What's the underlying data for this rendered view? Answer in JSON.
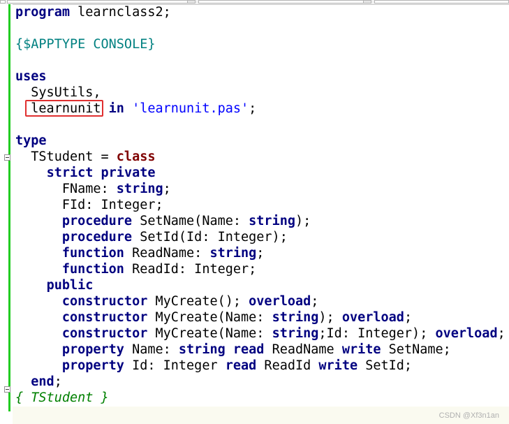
{
  "editor": {
    "lines": [
      [
        {
          "t": "program",
          "c": "kw"
        },
        {
          "t": " learnclass2;",
          "c": ""
        }
      ],
      [],
      [
        {
          "t": "{$APPTYPE CONSOLE}",
          "c": "dir"
        }
      ],
      [],
      [
        {
          "t": "uses",
          "c": "kw"
        }
      ],
      [
        {
          "t": "  SysUtils,",
          "c": ""
        }
      ],
      [
        {
          "t": "  learnunit",
          "c": ""
        },
        {
          "t": " in",
          "c": "kw"
        },
        {
          "t": " ",
          "c": ""
        },
        {
          "t": "'learnunit.pas'",
          "c": "str"
        },
        {
          "t": ";",
          "c": ""
        }
      ],
      [],
      [
        {
          "t": "type",
          "c": "kw"
        }
      ],
      [
        {
          "t": "  TStudent = ",
          "c": ""
        },
        {
          "t": "class",
          "c": "kw-red"
        }
      ],
      [
        {
          "t": "    ",
          "c": ""
        },
        {
          "t": "strict private",
          "c": "kw"
        }
      ],
      [
        {
          "t": "      FName: ",
          "c": ""
        },
        {
          "t": "string",
          "c": "kw"
        },
        {
          "t": ";",
          "c": ""
        }
      ],
      [
        {
          "t": "      FId: Integer;",
          "c": ""
        }
      ],
      [
        {
          "t": "      ",
          "c": ""
        },
        {
          "t": "procedure",
          "c": "kw"
        },
        {
          "t": " SetName(Name: ",
          "c": ""
        },
        {
          "t": "string",
          "c": "kw"
        },
        {
          "t": ");",
          "c": ""
        }
      ],
      [
        {
          "t": "      ",
          "c": ""
        },
        {
          "t": "procedure",
          "c": "kw"
        },
        {
          "t": " SetId(Id: Integer);",
          "c": ""
        }
      ],
      [
        {
          "t": "      ",
          "c": ""
        },
        {
          "t": "function",
          "c": "kw"
        },
        {
          "t": " ReadName: ",
          "c": ""
        },
        {
          "t": "string",
          "c": "kw"
        },
        {
          "t": ";",
          "c": ""
        }
      ],
      [
        {
          "t": "      ",
          "c": ""
        },
        {
          "t": "function",
          "c": "kw"
        },
        {
          "t": " ReadId: Integer;",
          "c": ""
        }
      ],
      [
        {
          "t": "    ",
          "c": ""
        },
        {
          "t": "public",
          "c": "kw"
        }
      ],
      [
        {
          "t": "      ",
          "c": ""
        },
        {
          "t": "constructor",
          "c": "kw"
        },
        {
          "t": " MyCreate(); ",
          "c": ""
        },
        {
          "t": "overload",
          "c": "kw"
        },
        {
          "t": ";",
          "c": ""
        }
      ],
      [
        {
          "t": "      ",
          "c": ""
        },
        {
          "t": "constructor",
          "c": "kw"
        },
        {
          "t": " MyCreate(Name: ",
          "c": ""
        },
        {
          "t": "string",
          "c": "kw"
        },
        {
          "t": "); ",
          "c": ""
        },
        {
          "t": "overload",
          "c": "kw"
        },
        {
          "t": ";",
          "c": ""
        }
      ],
      [
        {
          "t": "      ",
          "c": ""
        },
        {
          "t": "constructor",
          "c": "kw"
        },
        {
          "t": " MyCreate(Name: ",
          "c": ""
        },
        {
          "t": "string",
          "c": "kw"
        },
        {
          "t": ";Id: Integer); ",
          "c": ""
        },
        {
          "t": "overload",
          "c": "kw"
        },
        {
          "t": ";",
          "c": ""
        }
      ],
      [
        {
          "t": "      ",
          "c": ""
        },
        {
          "t": "property",
          "c": "kw"
        },
        {
          "t": " Name: ",
          "c": ""
        },
        {
          "t": "string",
          "c": "kw"
        },
        {
          "t": " ",
          "c": ""
        },
        {
          "t": "read",
          "c": "kw"
        },
        {
          "t": " ReadName ",
          "c": ""
        },
        {
          "t": "write",
          "c": "kw"
        },
        {
          "t": " SetName;",
          "c": ""
        }
      ],
      [
        {
          "t": "      ",
          "c": ""
        },
        {
          "t": "property",
          "c": "kw"
        },
        {
          "t": " Id: Integer ",
          "c": ""
        },
        {
          "t": "read",
          "c": "kw"
        },
        {
          "t": " ReadId ",
          "c": ""
        },
        {
          "t": "write",
          "c": "kw"
        },
        {
          "t": " SetId;",
          "c": ""
        }
      ],
      [
        {
          "t": "  ",
          "c": ""
        },
        {
          "t": "end",
          "c": "kw"
        },
        {
          "t": ";",
          "c": ""
        }
      ],
      [
        {
          "t": "{ TStudent }",
          "c": "cmt"
        }
      ],
      []
    ],
    "highlight_color": "#e03030",
    "gutter_bar_color": "#22cc22"
  },
  "watermark": "CSDN @Xf3n1an"
}
